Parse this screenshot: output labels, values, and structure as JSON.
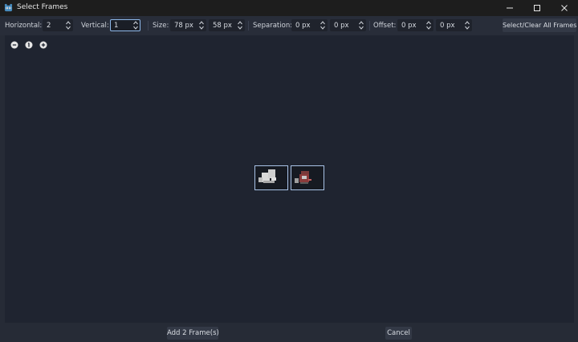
{
  "window": {
    "title": "Select Frames",
    "icon": "godot-icon",
    "controls": [
      "minimize-icon",
      "maximize-icon",
      "close-icon"
    ]
  },
  "toolbar": {
    "horizontal_label": "Horizontal:",
    "horizontal_value": "2",
    "vertical_label": "Vertical:",
    "vertical_value": "1",
    "size_label": "Size:",
    "size_x": "78 px",
    "size_y": "58 px",
    "separation_label": "Separation:",
    "separation_x": "0 px",
    "separation_y": "0 px",
    "offset_label": "Offset:",
    "offset_x": "0 px",
    "offset_y": "0 px",
    "select_clear_label": "Select/Clear All Frames"
  },
  "zoom": {
    "zoom_out_icon": "zoom-out-icon",
    "zoom_reset_icon": "zoom-reset-icon",
    "zoom_in_icon": "zoom-in-icon"
  },
  "frames": [
    {
      "index": 0,
      "selected": true
    },
    {
      "index": 1,
      "selected": true
    }
  ],
  "footer": {
    "add_label": "Add 2 Frame(s)",
    "cancel_label": "Cancel"
  },
  "colors": {
    "background": "#1f2430",
    "toolbar": "#282d39",
    "titlebar": "#1d1d1d",
    "frame_border": "#a8c2e6",
    "focus_border": "#8db7e8",
    "godot_blue": "#478cbf"
  }
}
